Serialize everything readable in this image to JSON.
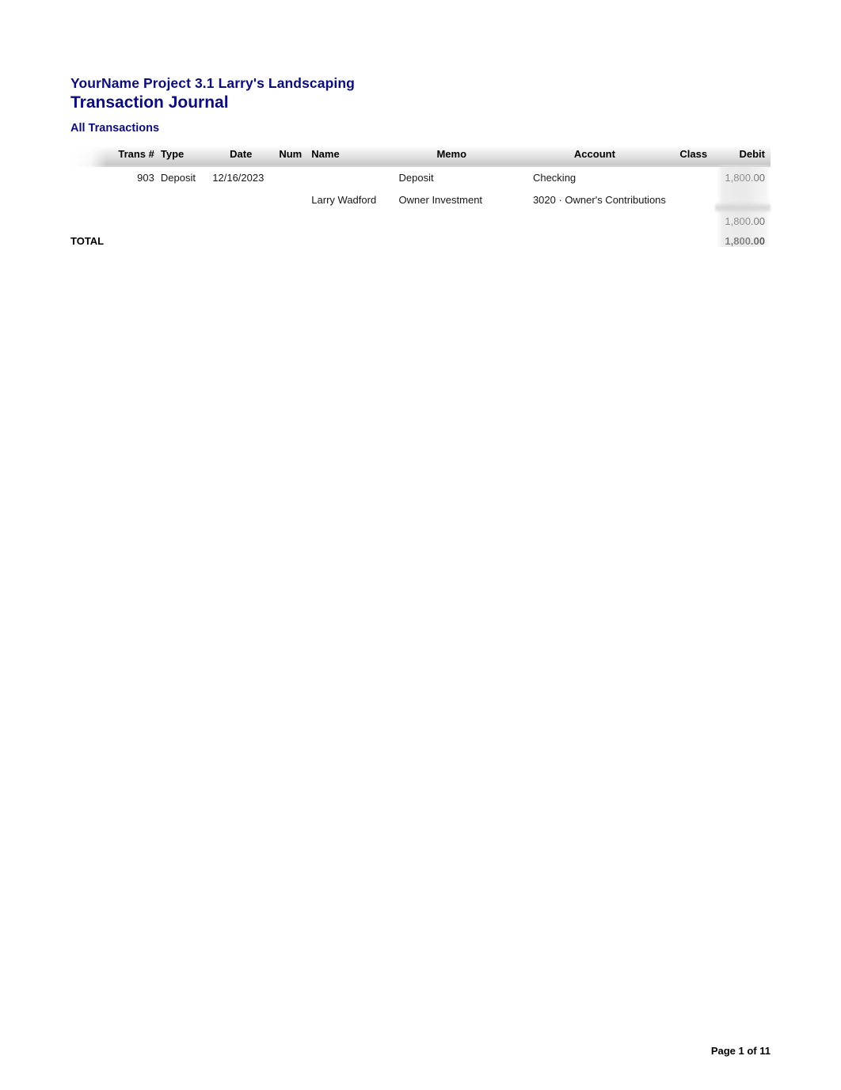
{
  "report": {
    "company": "YourName Project 3.1 Larry's Landscaping",
    "title": "Transaction Journal",
    "subtitle": "All Transactions",
    "title_color": "#0d0d7a"
  },
  "table": {
    "columns": [
      {
        "key": "trans",
        "label": "Trans #"
      },
      {
        "key": "type",
        "label": "Type"
      },
      {
        "key": "date",
        "label": "Date"
      },
      {
        "key": "num",
        "label": "Num"
      },
      {
        "key": "name",
        "label": "Name"
      },
      {
        "key": "memo",
        "label": "Memo"
      },
      {
        "key": "account",
        "label": "Account"
      },
      {
        "key": "class",
        "label": "Class"
      },
      {
        "key": "debit",
        "label": "Debit"
      }
    ],
    "rows": [
      {
        "trans": "903",
        "type": "Deposit",
        "date": "12/16/2023",
        "num": "",
        "name": "",
        "memo": "Deposit",
        "account": "Checking",
        "class": "",
        "debit": "1,800.00"
      },
      {
        "trans": "",
        "type": "",
        "date": "",
        "num": "",
        "name": "Larry Wadford",
        "memo": "Owner Investment",
        "account": "3020 · Owner's Contributions",
        "class": "",
        "debit": ""
      }
    ],
    "subtotal": {
      "debit": "1,800.00"
    },
    "total": {
      "label": "TOTAL",
      "debit": "1,800.00"
    }
  },
  "footer": {
    "page_text": "Page 1 of 11"
  }
}
